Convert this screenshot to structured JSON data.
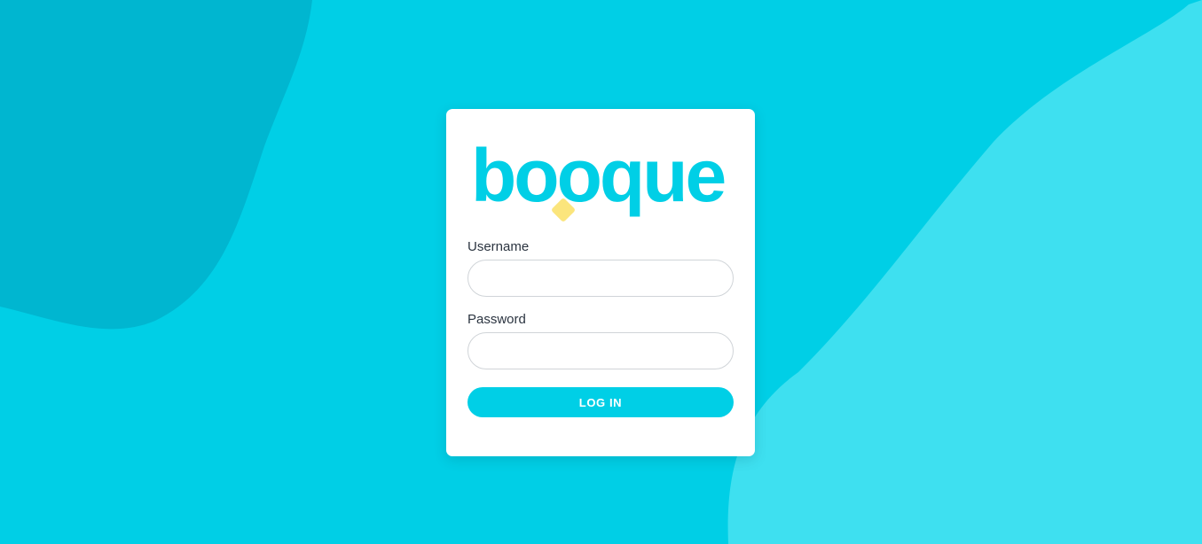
{
  "brand": {
    "logo_text": "booque",
    "logo_color": "#00cfe6",
    "accent_color": "#fbe57c"
  },
  "theme": {
    "background": "#00cfe6",
    "shape_dark": "#00b6d0",
    "shape_light": "#3ee0f0",
    "card_background": "#ffffff",
    "button_color": "#00cfe6"
  },
  "form": {
    "username_label": "Username",
    "username_value": "",
    "username_placeholder": "",
    "password_label": "Password",
    "password_value": "",
    "password_placeholder": "",
    "submit_label": "LOG IN"
  }
}
